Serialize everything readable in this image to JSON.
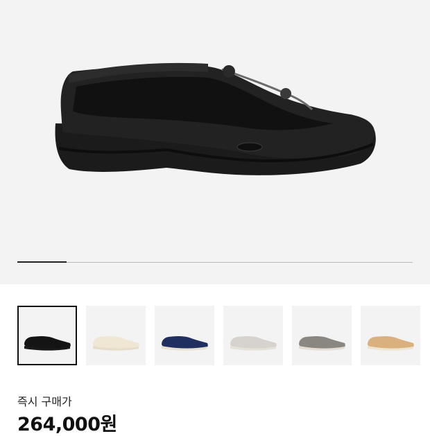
{
  "hero": {
    "image": "black-slip-on-shoe",
    "carousel_progress": 0.125
  },
  "thumbnails": [
    {
      "name": "thumb-black-shoe",
      "color": "#141414",
      "sole": "#1a1a1a",
      "selected": true
    },
    {
      "name": "thumb-cream-shoe",
      "color": "#efe6d4",
      "sole": "#e6dcc8",
      "selected": false
    },
    {
      "name": "thumb-navy-sneaker",
      "color": "#1f2f60",
      "sole": "#e8e1cf",
      "selected": false
    },
    {
      "name": "thumb-grey-maroon-sneaker",
      "color": "#d6d2cd",
      "sole": "#e6e1d8",
      "selected": false
    },
    {
      "name": "thumb-grey-sneaker",
      "color": "#8a8780",
      "sole": "#e3ddd3",
      "selected": false
    },
    {
      "name": "thumb-tan-sneaker",
      "color": "#d9b07e",
      "sole": "#efe4d0",
      "selected": false
    }
  ],
  "price": {
    "label": "즉시 구매가",
    "value": "264,000원"
  }
}
